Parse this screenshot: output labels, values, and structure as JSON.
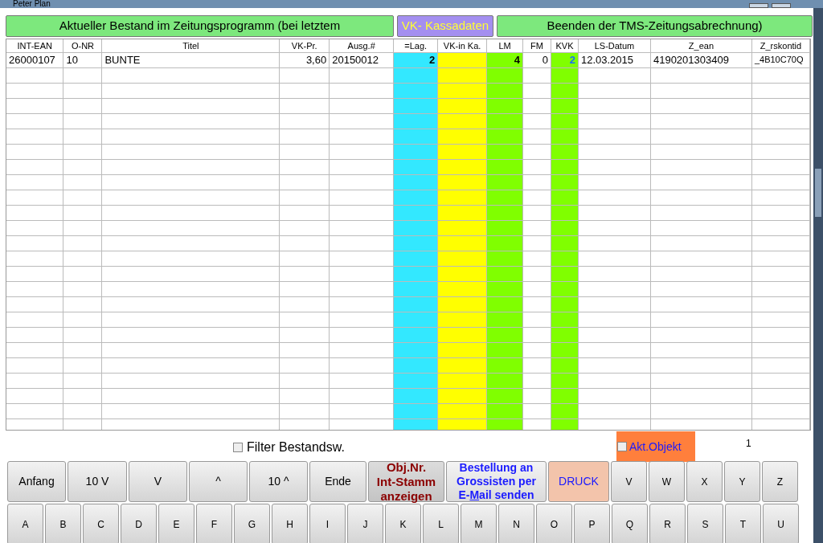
{
  "window": {
    "title": "Peter Plan"
  },
  "top_buttons": [
    {
      "label": "Aktueller Bestand im Zeitungsprogramm (bei letztem",
      "kind": "green"
    },
    {
      "label": "VK- Kassadaten",
      "kind": "purple"
    },
    {
      "label": "Beenden der TMS-Zeitungsabrechnung)",
      "kind": "green"
    }
  ],
  "table": {
    "columns": [
      {
        "label": "INT-EAN",
        "kind": "text",
        "color": "#ffffff"
      },
      {
        "label": "O-NR",
        "kind": "text",
        "color": "#ffffff"
      },
      {
        "label": "Titel",
        "kind": "text",
        "color": "#ffffff"
      },
      {
        "label": "VK-Pr.",
        "kind": "number",
        "color": "#ffffff"
      },
      {
        "label": "Ausg.#",
        "kind": "text",
        "color": "#ffffff"
      },
      {
        "label": "=Lag.",
        "kind": "bold",
        "color": "#33e8ff"
      },
      {
        "label": "VK-in Ka.",
        "kind": "bold",
        "color": "#ffff00"
      },
      {
        "label": "LM",
        "kind": "bold",
        "color": "#80ff00"
      },
      {
        "label": "FM",
        "kind": "number",
        "color": "#ffffff"
      },
      {
        "label": "KVK",
        "kind": "blue",
        "color": "#80ff00"
      },
      {
        "label": "LS-Datum",
        "kind": "text",
        "color": "#ffffff"
      },
      {
        "label": "Z_ean",
        "kind": "text",
        "color": "#ffffff"
      },
      {
        "label": "Z_rskontid",
        "kind": "small",
        "color": "#ffffff"
      }
    ],
    "rows": [
      [
        "26000107",
        "10",
        "BUNTE",
        "3,60",
        "20150012",
        "2",
        "",
        "4",
        "0",
        "2",
        "12.03.2015",
        "4190201303409",
        "_4B10C70Q"
      ]
    ]
  },
  "filter": {
    "label": "Filter Bestandsw.",
    "checked": false
  },
  "akt_objekt": {
    "label": "Akt.Objekt",
    "checked": false
  },
  "counter": "1",
  "button_row": [
    {
      "label": "Anfang",
      "kind": "nav"
    },
    {
      "label": "10 V",
      "kind": "nav"
    },
    {
      "label": "V",
      "kind": "nav"
    },
    {
      "label": "^",
      "kind": "nav"
    },
    {
      "label": "10 ^",
      "kind": "nav"
    },
    {
      "label": "Ende",
      "kind": "nav"
    },
    {
      "label": "Obj.Nr.\nInt-Stamm\nanzeigen",
      "kind": "stamm"
    },
    {
      "label": "Bestellung an\nGrossisten per\nE-**M**ail senden",
      "kind": "email"
    },
    {
      "label": "DRUCK",
      "kind": "print"
    },
    {
      "label": "V",
      "kind": "key"
    },
    {
      "label": "W",
      "kind": "key"
    },
    {
      "label": "X",
      "kind": "key"
    },
    {
      "label": "Y",
      "kind": "key"
    },
    {
      "label": "Z",
      "kind": "key"
    }
  ],
  "key_row": [
    "A",
    "B",
    "C",
    "D",
    "E",
    "F",
    "G",
    "H",
    "I",
    "J",
    "K",
    "L",
    "M",
    "N",
    "O",
    "P",
    "Q",
    "R",
    "S",
    "T",
    "U"
  ]
}
